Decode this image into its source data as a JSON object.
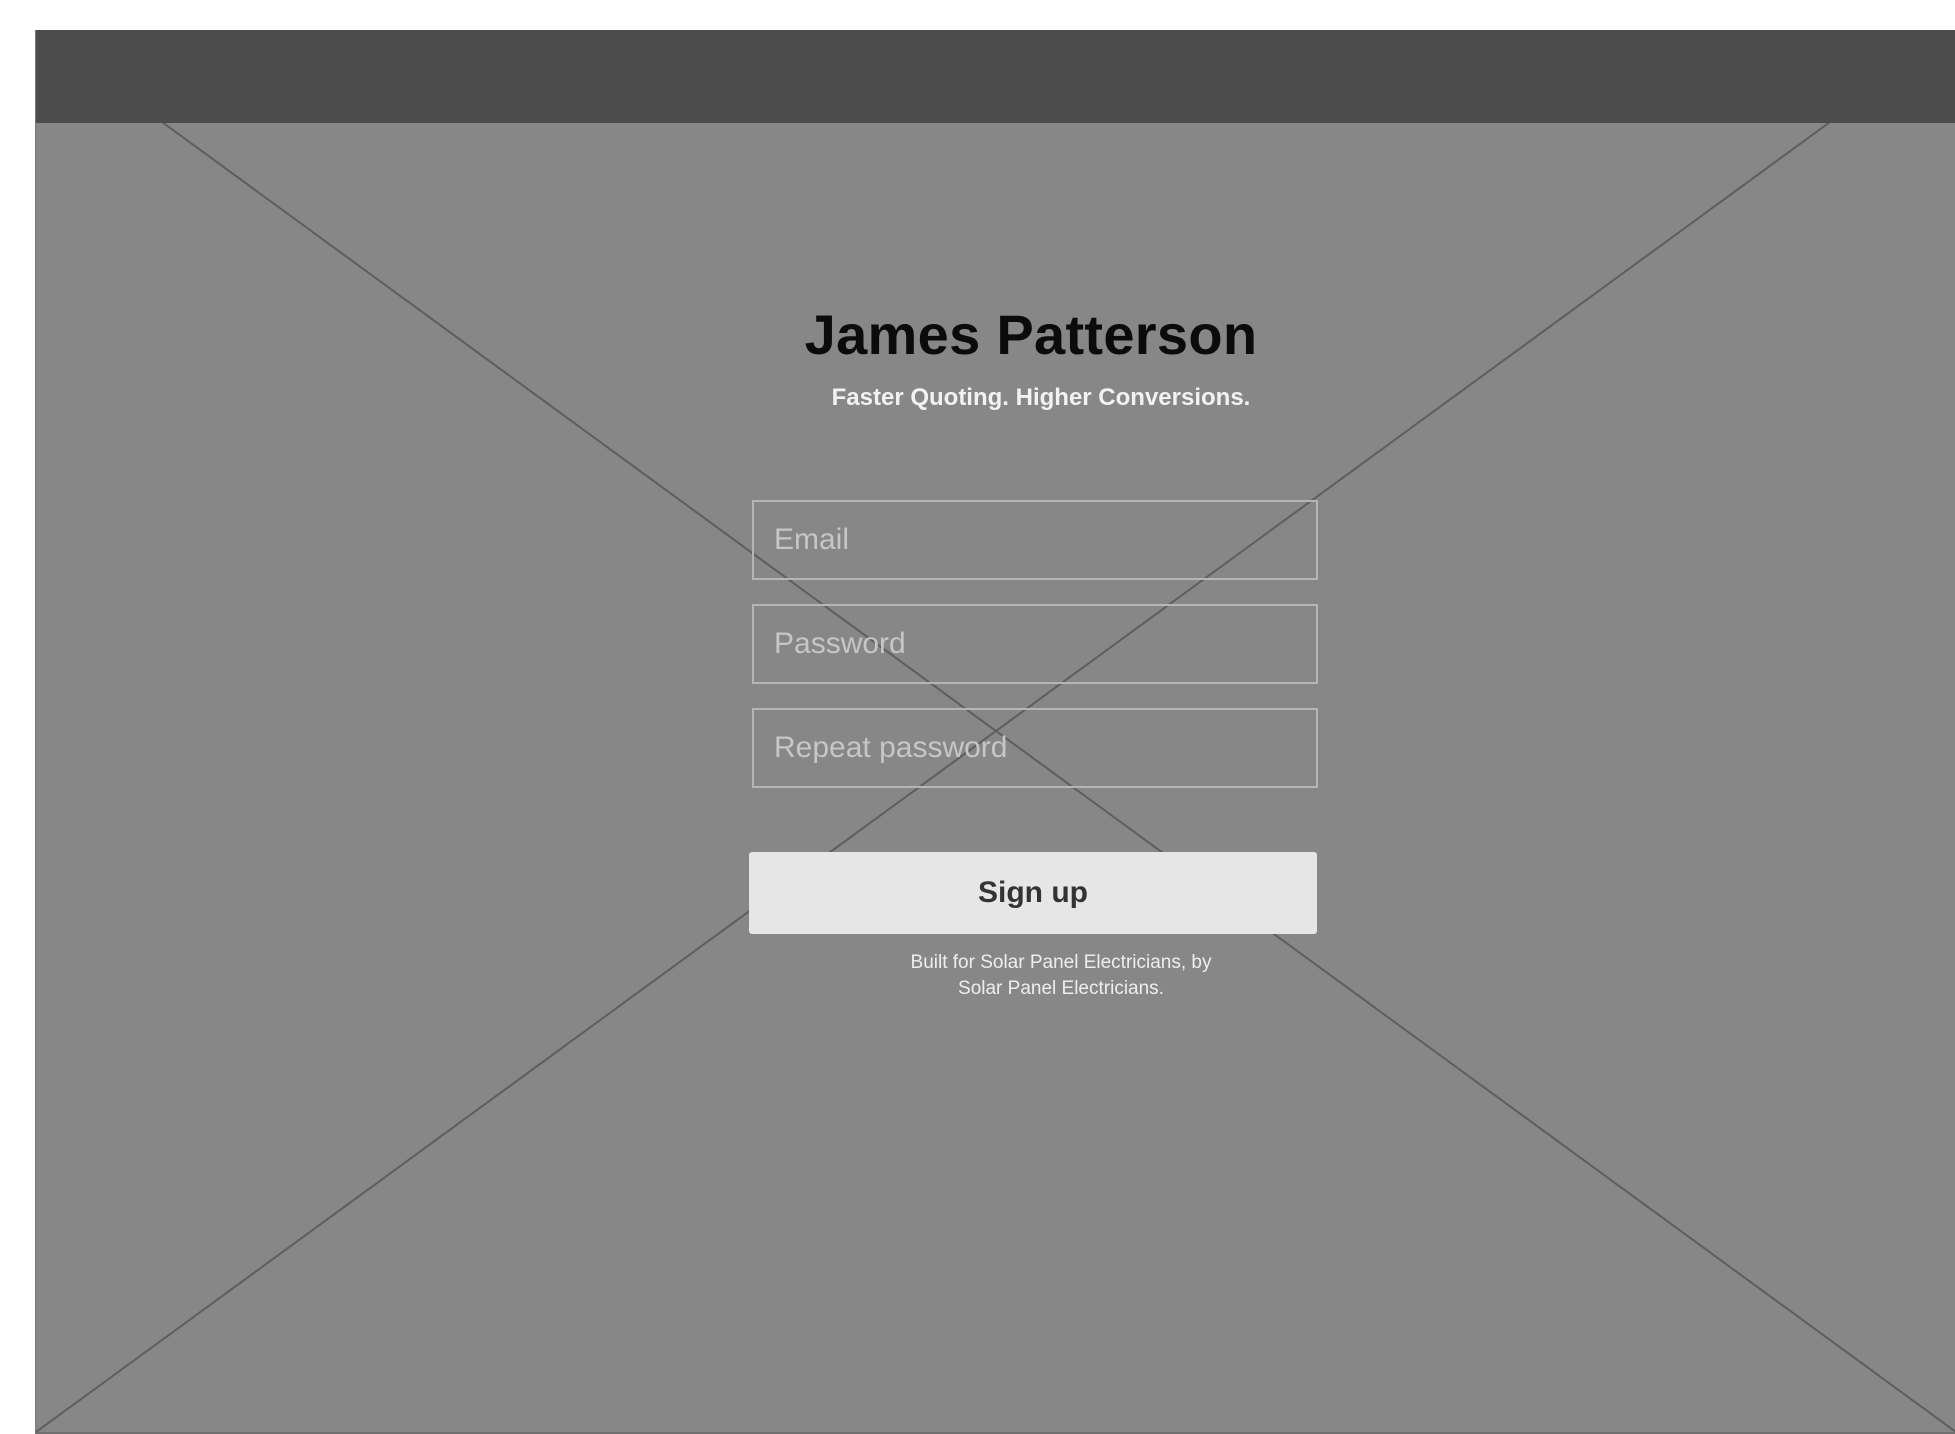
{
  "header": {
    "title": "James Patterson",
    "tagline": "Faster Quoting. Higher Conversions."
  },
  "form": {
    "email_placeholder": "Email",
    "password_placeholder": "Password",
    "repeat_password_placeholder": "Repeat password",
    "signup_label": "Sign up"
  },
  "footer": {
    "line1": "Built for Solar Panel Electricians, by",
    "line2": "Solar Panel Electricians."
  },
  "colors": {
    "background": "#878787",
    "topbar": "#4c4c4c",
    "button": "#e6e6e6"
  },
  "icons": {
    "background_image": "image-placeholder-cross-icon"
  }
}
